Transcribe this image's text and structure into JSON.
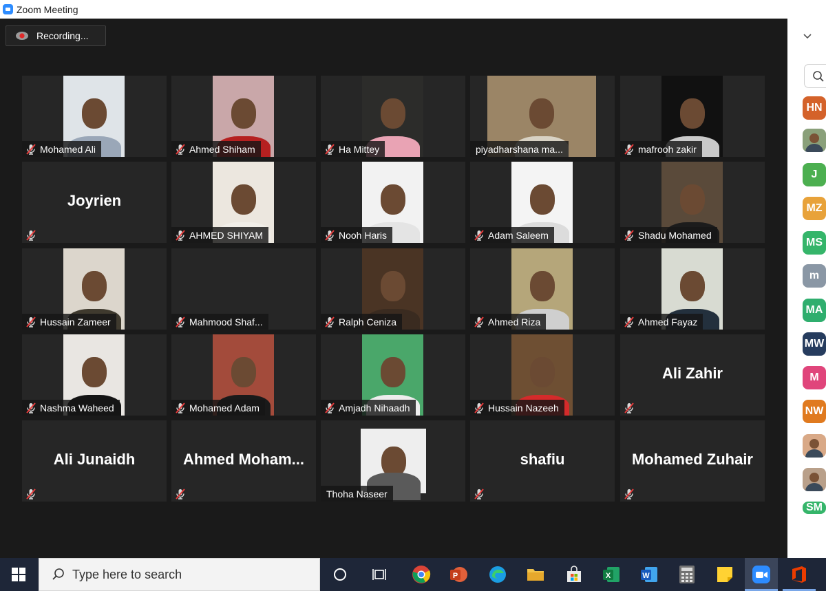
{
  "window": {
    "title": "Zoom Meeting"
  },
  "recording": {
    "label": "Recording..."
  },
  "participants": [
    {
      "name": "Mohamed Ali",
      "video": true,
      "muted": true
    },
    {
      "name": "Ahmed Shiham",
      "video": true,
      "muted": true
    },
    {
      "name": "Ha Mittey",
      "video": true,
      "muted": true
    },
    {
      "name": "piyadharshana ma...",
      "video": true,
      "muted": false
    },
    {
      "name": "mafrooh zakir",
      "video": true,
      "muted": true
    },
    {
      "name": "Joyrien",
      "video": false,
      "muted": true
    },
    {
      "name": "AHMED SHIYAM",
      "video": true,
      "muted": true
    },
    {
      "name": "Nooh Haris",
      "video": true,
      "muted": true
    },
    {
      "name": "Adam Saleem",
      "video": true,
      "muted": true
    },
    {
      "name": "Shadu Mohamed",
      "video": true,
      "muted": true
    },
    {
      "name": "Hussain Zameer",
      "video": true,
      "muted": true
    },
    {
      "name": "Mahmood Shaf...",
      "video": true,
      "muted": true
    },
    {
      "name": "Ralph Ceniza",
      "video": true,
      "muted": true
    },
    {
      "name": "Ahmed Riza",
      "video": true,
      "muted": true
    },
    {
      "name": "Ahmed Fayaz",
      "video": true,
      "muted": true
    },
    {
      "name": "Nashma Waheed",
      "video": true,
      "muted": true
    },
    {
      "name": "Mohamed Adam",
      "video": true,
      "muted": true
    },
    {
      "name": "Amjadh Nihaadh",
      "video": true,
      "muted": true
    },
    {
      "name": "Hussain Nazeeh",
      "video": true,
      "muted": true
    },
    {
      "name": "Ali Zahir",
      "video": false,
      "muted": true
    },
    {
      "name": "Ali Junaidh",
      "video": false,
      "muted": true
    },
    {
      "name": "Ahmed  Moham...",
      "video": false,
      "muted": true
    },
    {
      "name": "Thoha Naseer",
      "video": true,
      "muted": false
    },
    {
      "name": "shafiu",
      "video": false,
      "muted": true
    },
    {
      "name": "Mohamed Zuhair",
      "video": false,
      "muted": false
    }
  ],
  "sidebar": {
    "avatars": [
      {
        "initials": "HN",
        "color": "#d4622a"
      },
      {
        "initials": "",
        "color": "#8aa07a",
        "photo": true
      },
      {
        "initials": "J",
        "color": "#4caf50"
      },
      {
        "initials": "MZ",
        "color": "#e8a23a"
      },
      {
        "initials": "MS",
        "color": "#35b56a"
      },
      {
        "initials": "m",
        "color": "#8a97a5"
      },
      {
        "initials": "MA",
        "color": "#2fae6e"
      },
      {
        "initials": "MW",
        "color": "#263c5e"
      },
      {
        "initials": "M",
        "color": "#e0457b"
      },
      {
        "initials": "NW",
        "color": "#e07a1f"
      },
      {
        "initials": "",
        "color": "#d9a987",
        "photo": true
      },
      {
        "initials": "",
        "color": "#b9a08a",
        "photo": true
      },
      {
        "initials": "SM",
        "color": "#35b56a"
      }
    ]
  },
  "taskbar": {
    "search_placeholder": "Type here to search",
    "apps": [
      "task-view",
      "chrome",
      "powerpoint",
      "edge",
      "file-explorer",
      "store",
      "excel",
      "word",
      "calculator",
      "sticky-notes",
      "zoom",
      "office"
    ]
  }
}
